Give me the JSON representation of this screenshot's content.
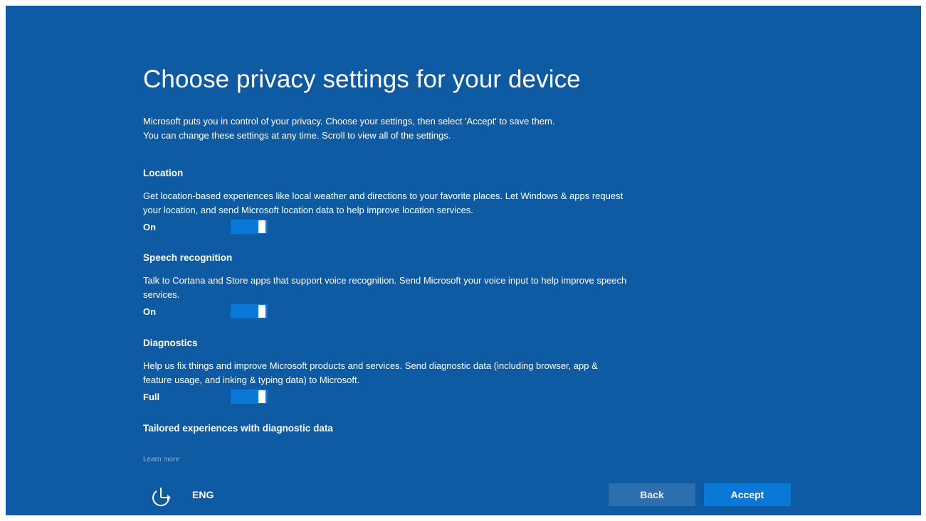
{
  "page": {
    "title": "Choose privacy settings for your device",
    "intro_line1": "Microsoft puts you in control of your privacy. Choose your settings, then select 'Accept' to save them.",
    "intro_line2": "You can change these settings at any time. Scroll to view all of the settings."
  },
  "sections": [
    {
      "title": "Location",
      "description": "Get location-based experiences like local weather and directions to your favorite places. Let Windows & apps request your location, and send Microsoft location data to help improve location services.",
      "toggle_label": "On",
      "toggle_state": "on"
    },
    {
      "title": "Speech recognition",
      "description": "Talk to Cortana and Store apps that support voice recognition. Send Microsoft your voice input to help improve speech services.",
      "toggle_label": "On",
      "toggle_state": "on"
    },
    {
      "title": "Diagnostics",
      "description": "Help us fix things and improve Microsoft products and services. Send diagnostic data (including browser, app & feature usage, and inking & typing data) to Microsoft.",
      "toggle_label": "Full",
      "toggle_state": "on"
    },
    {
      "title": "Tailored experiences with diagnostic data"
    }
  ],
  "footer": {
    "learn_more": "Learn more",
    "accessibility_icon": "ease-of-access-icon",
    "language": "ENG",
    "back_label": "Back",
    "accept_label": "Accept"
  },
  "colors": {
    "background": "#0f5ba3",
    "toggle_on": "#0a78d7",
    "accept_button": "#0a78d7",
    "back_button": "#2d6fae"
  }
}
